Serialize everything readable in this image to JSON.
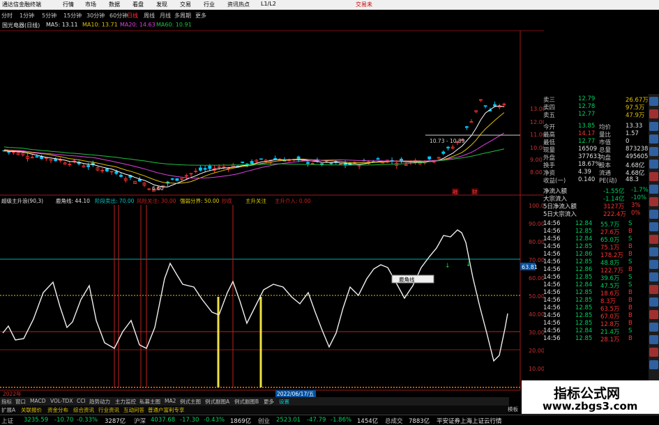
{
  "app": {
    "title": "通达信金融终端",
    "menus": [
      "行情",
      "市场",
      "数据",
      "看盘",
      "发现",
      "交易",
      "行业",
      "资讯",
      "热点",
      "L1/L2"
    ],
    "corner": "交易未"
  },
  "periods": {
    "items": [
      "分时",
      "1分钟",
      "5分钟",
      "15分钟",
      "30分钟",
      "60分钟",
      "日线",
      "周线",
      "月线",
      "多周期",
      "更多"
    ],
    "active": "日线"
  },
  "stock": {
    "name": "国光电器(日线)",
    "ma5": "MA5: 13.11",
    "ma10": "MA10: 13.71",
    "ma20": "MA20: 14.63",
    "ma60": "MA60: 10.91",
    "low_label": "6.60",
    "box_label": "10.73 - 10.89",
    "price_axis": [
      "13.00",
      "12.00",
      "11.00",
      "10.00",
      "9.00",
      "8.00"
    ],
    "event_badges": [
      "融",
      "财"
    ]
  },
  "indicator": {
    "title": "超级主升浪(90,3)",
    "parts": [
      {
        "text": "鹿角线: 44.10",
        "color": "#e0e0e0"
      },
      {
        "text": "阶段卖出: 70.00",
        "color": "#00c8c8"
      },
      {
        "text": "风险关注: 30.00",
        "color": "#d02020"
      },
      {
        "text": "强弱分界: 50.00",
        "color": "#e0d000"
      },
      {
        "text": "抄底",
        "color": "#d02020"
      },
      {
        "text": "主升关注",
        "color": "#e0d000"
      },
      {
        "text": "主升介入: 0.00",
        "color": "#d02020"
      }
    ],
    "axis": [
      "100.00",
      "90.00",
      "80.00",
      "70.00",
      "60.00",
      "50.00",
      "40.00",
      "30.00",
      "20.00",
      "10.00"
    ],
    "current_value": "63.81",
    "date_tag": "2022/06/17/五",
    "tooltip": "鹿角线"
  },
  "year_label": "2022年",
  "quote": {
    "book": [
      {
        "label": "卖三",
        "price": "12.79",
        "vol": "26.67万"
      },
      {
        "label": "卖四",
        "price": "12.78",
        "vol": "97.5万"
      },
      {
        "label": "卖五",
        "price": "12.77",
        "vol": "47.9万"
      }
    ],
    "stats": [
      {
        "l1": "今开",
        "v1": "13.85",
        "l2": "均价",
        "v2": "13.33"
      },
      {
        "l1": "最高",
        "v1": "14.17",
        "l2": "量比",
        "v2": "1.57"
      },
      {
        "l1": "最低",
        "v1": "12.77",
        "l2": "市值",
        "v2": "0"
      },
      {
        "l1": "现量",
        "v1": "16509",
        "l2": "总量",
        "v2": "873238"
      },
      {
        "l1": "外盘",
        "v1": "377633",
        "l2": "内盘",
        "v2": "495605"
      },
      {
        "l1": "换手",
        "v1": "18.67%",
        "l2": "股本",
        "v2": "4.68亿"
      },
      {
        "l1": "净资",
        "v1": "4.39",
        "l2": "流通",
        "v2": "4.68亿"
      },
      {
        "l1": "收益(一)",
        "v1": "0.140",
        "l2": "PE(动)",
        "v2": "48.3"
      }
    ],
    "flows": [
      {
        "label": "净流入额",
        "value": "-1.55亿",
        "pct": "-1.7%"
      },
      {
        "label": "大宗流入",
        "value": "-1.14亿",
        "pct": "-10%"
      },
      {
        "label": "5日净流入额",
        "value": "3127万",
        "pct": "3%"
      },
      {
        "label": "5日大宗流入",
        "value": "222.4万",
        "pct": "0%"
      }
    ],
    "ticks": [
      {
        "t": "14:56",
        "p": "12.84",
        "v": "55.7万",
        "s": "S"
      },
      {
        "t": "14:56",
        "p": "12.85",
        "v": "27.6万",
        "s": "B"
      },
      {
        "t": "14:56",
        "p": "12.84",
        "v": "65.0万",
        "s": "S"
      },
      {
        "t": "14:56",
        "p": "12.85",
        "v": "75.1万",
        "s": "B"
      },
      {
        "t": "14:56",
        "p": "12.86",
        "v": "178.2万",
        "s": "B"
      },
      {
        "t": "14:56",
        "p": "12.85",
        "v": "48.8万",
        "s": "S"
      },
      {
        "t": "14:56",
        "p": "12.86",
        "v": "122.7万",
        "s": "B"
      },
      {
        "t": "14:56",
        "p": "12.85",
        "v": "39.6万",
        "s": "S"
      },
      {
        "t": "14:56",
        "p": "12.84",
        "v": "47.5万",
        "s": "S"
      },
      {
        "t": "14:56",
        "p": "12.85",
        "v": "18.6万",
        "s": "B"
      },
      {
        "t": "14:56",
        "p": "12.85",
        "v": "8.3万",
        "s": "B"
      },
      {
        "t": "14:56",
        "p": "12.85",
        "v": "63.5万",
        "s": "B"
      },
      {
        "t": "14:56",
        "p": "12.85",
        "v": "67.0万",
        "s": "B"
      },
      {
        "t": "14:56",
        "p": "12.85",
        "v": "12.8万",
        "s": "B"
      },
      {
        "t": "14:56",
        "p": "12.84",
        "v": "21.4万",
        "s": "S"
      },
      {
        "t": "14:56",
        "p": "12.85",
        "v": "28.1万",
        "s": "B"
      }
    ]
  },
  "bottom_tabs": [
    "指标",
    "窗口",
    "MACD",
    "VOL-TDX",
    "CCI",
    "趋势动力",
    "主力监控",
    "私募主图",
    "MA2",
    "例式主图",
    "例式副图A",
    "例式副图B",
    "更多",
    "设置"
  ],
  "sub_tabs": [
    "扩展A",
    "关联报价",
    "资金分布",
    "综合资讯",
    "行业资讯",
    "互动问答",
    "普通户富利专享"
  ],
  "status": {
    "sh_label": "上证",
    "sh_value": "3235.59",
    "sh_chg": "-10.70",
    "sh_pct": "-0.33%",
    "sh_amt": "3287亿",
    "hs_label": "沪深",
    "hs_value": "4037.68",
    "hs_chg": "-17.30",
    "hs_pct": "-0.43%",
    "hs_amt": "1869亿",
    "cy_label": "创业",
    "cy_value": "2523.01",
    "cy_chg": "-47.79",
    "cy_pct": "-1.86%",
    "cy_amt": "1454亿",
    "total_label": "总成交",
    "total_value": "7883亿",
    "broker": "平安证券上海上证云行情",
    "tail_label": "模板"
  },
  "watermark": {
    "line1": "指标公式网",
    "line2": "www.zbgs3.com"
  },
  "colors": {
    "up": "#ff3232",
    "down": "#00d060",
    "ma5": "#ffffff",
    "ma10": "#e0c000",
    "ma20": "#e040e0",
    "ma60": "#20c040",
    "accent": "#00c8c8"
  }
}
